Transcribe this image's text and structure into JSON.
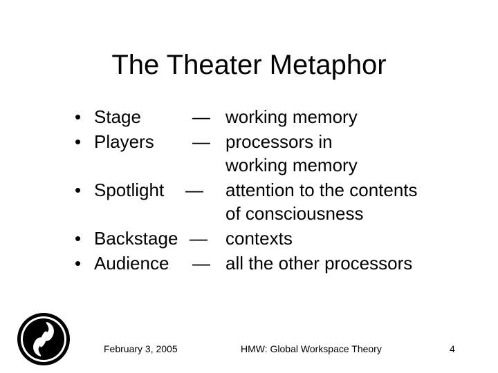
{
  "slide": {
    "title": "The Theater Metaphor",
    "bullet_symbol": "•",
    "dash": "—",
    "items": [
      {
        "term": "Stage",
        "definition_lines": [
          "working memory"
        ]
      },
      {
        "term": "Players",
        "definition_lines": [
          "processors in",
          "working memory"
        ]
      },
      {
        "term": "Spotlight",
        "definition_lines": [
          "attention to the contents",
          "of consciousness"
        ]
      },
      {
        "term": "Backstage",
        "definition_lines": [
          "contexts"
        ]
      },
      {
        "term": "Audience",
        "definition_lines": [
          "all the other processors"
        ]
      }
    ]
  },
  "footer": {
    "date": "February 3, 2005",
    "title": "HMW: Global Workspace Theory",
    "page_number": "4"
  },
  "logo": {
    "icon": "circular-emblem-icon"
  }
}
